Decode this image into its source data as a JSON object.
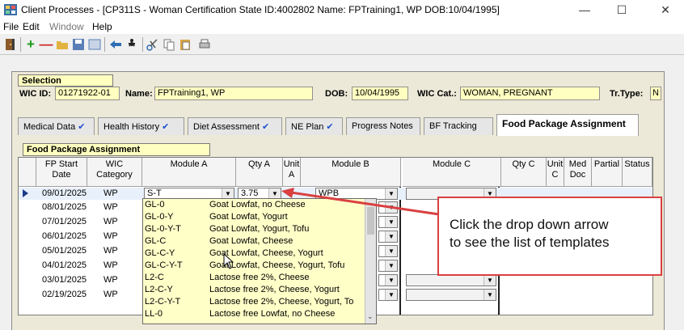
{
  "window": {
    "title": "Client Processes - [CP311S - Woman Certification  State ID:4002802  Name: FPTraining1, WP   DOB:10/04/1995]",
    "minimize": "—",
    "maximize": "☐",
    "close": "✕"
  },
  "menu": [
    "File",
    "Edit",
    "Window",
    "Help"
  ],
  "toolbar_icons": [
    "exit-icon",
    "add-icon",
    "remove-icon",
    "open-icon",
    "save-icon",
    "preview-icon",
    "back-icon",
    "run-icon",
    "cut-icon",
    "copy-icon",
    "paste-icon",
    "print-icon"
  ],
  "selection": {
    "header": "Selection",
    "wic_id_label": "WIC ID:",
    "wic_id": "01271922-01",
    "name_label": "Name:",
    "name": "FPTraining1, WP",
    "dob_label": "DOB:",
    "dob": "10/04/1995",
    "wic_cat_label": "WIC Cat.:",
    "wic_cat": "WOMAN, PREGNANT",
    "tr_type_label": "Tr.Type:",
    "tr_type": "N"
  },
  "tabs": [
    {
      "label": "Medical Data",
      "check": "✔"
    },
    {
      "label": "Health History",
      "check": "✔"
    },
    {
      "label": "Diet Assessment",
      "check": "✔"
    },
    {
      "label": "NE Plan",
      "check": "✔"
    },
    {
      "label": "Progress Notes",
      "check": ""
    },
    {
      "label": "BF Tracking",
      "check": ""
    },
    {
      "label": "Food Package Assignment",
      "check": ""
    }
  ],
  "section_header": "Food Package Assignment",
  "grid": {
    "columns": {
      "fp_start": "FP Start\nDate",
      "wic_cat": "WIC\nCategory",
      "module_a": "Module A",
      "qty_a": "Qty A",
      "unit_a": "Unit\nA",
      "module_b": "Module B",
      "module_c": "Module C",
      "qty_c": "Qty C",
      "unit_c": "Unit\nC",
      "med_doc": "Med\nDoc",
      "partial": "Partial",
      "status": "Status"
    },
    "rows": [
      {
        "date": "09/01/2025",
        "cat": "WP"
      },
      {
        "date": "08/01/2025",
        "cat": "WP"
      },
      {
        "date": "07/01/2025",
        "cat": "WP"
      },
      {
        "date": "06/01/2025",
        "cat": "WP"
      },
      {
        "date": "05/01/2025",
        "cat": "WP"
      },
      {
        "date": "04/01/2025",
        "cat": "WP"
      },
      {
        "date": "03/01/2025",
        "cat": "WP"
      },
      {
        "date": "02/19/2025",
        "cat": "WP"
      }
    ],
    "current_row": {
      "module_a": "S-T",
      "qty_a": "3.75",
      "module_b": "WPB"
    }
  },
  "dropdown": [
    {
      "code": "GL-0",
      "desc": "Goat Lowfat, no Cheese"
    },
    {
      "code": "GL-0-Y",
      "desc": "Goat Lowfat, Yogurt"
    },
    {
      "code": "GL-0-Y-T",
      "desc": "Goat Lowfat, Yogurt, Tofu"
    },
    {
      "code": "GL-C",
      "desc": "Goat Lowfat, Cheese"
    },
    {
      "code": "GL-C-Y",
      "desc": "Goat Lowfat, Cheese, Yogurt"
    },
    {
      "code": "GL-C-Y-T",
      "desc": "Goat Lowfat, Cheese, Yogurt, Tofu"
    },
    {
      "code": "L2-C",
      "desc": "Lactose free 2%, Cheese"
    },
    {
      "code": "L2-C-Y",
      "desc": "Lactose free 2%, Cheese, Yogurt"
    },
    {
      "code": "L2-C-Y-T",
      "desc": "Lactose free 2%, Cheese, Yogurt, To"
    },
    {
      "code": "LL-0",
      "desc": "Lactose free Lowfat, no Cheese"
    }
  ],
  "callout": {
    "line1": "Click the drop down arrow",
    "line2": "to see the list of templates"
  },
  "colors": {
    "accent_red": "#d94040",
    "yellow_field": "#ffffc0",
    "check_blue": "#1a4fd0"
  }
}
